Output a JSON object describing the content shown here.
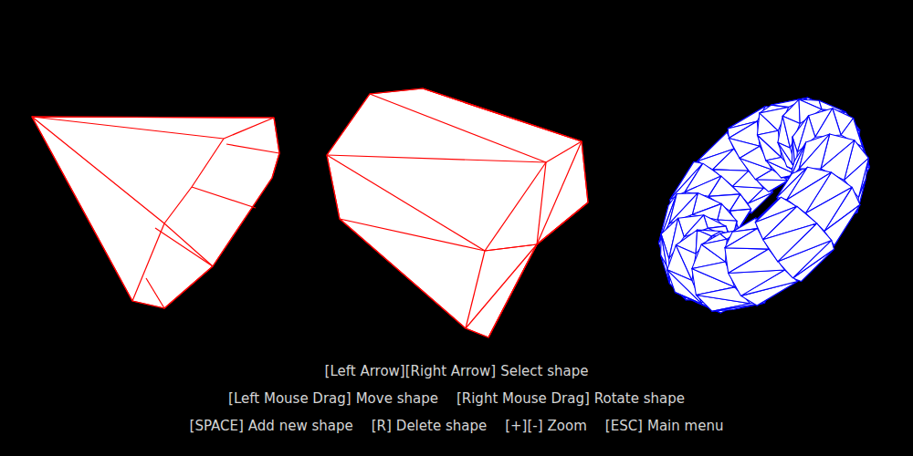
{
  "shapes": [
    {
      "kind": "tetrahedron",
      "selected": false,
      "color": "#ff0000"
    },
    {
      "kind": "box",
      "selected": false,
      "color": "#ff0000"
    },
    {
      "kind": "torus",
      "selected": true,
      "color": "#0000ff"
    }
  ],
  "controls": [
    [
      {
        "key": "[Left Arrow][Right Arrow]",
        "action": "Select shape"
      }
    ],
    [
      {
        "key": "[Left Mouse Drag]",
        "action": "Move shape"
      },
      {
        "key": "[Right Mouse Drag]",
        "action": "Rotate shape"
      }
    ],
    [
      {
        "key": "[SPACE]",
        "action": "Add new shape"
      },
      {
        "key": "[R]",
        "action": "Delete shape"
      },
      {
        "key": "[+][-]",
        "action": "Zoom"
      },
      {
        "key": "[ESC]",
        "action": "Main menu"
      }
    ]
  ]
}
